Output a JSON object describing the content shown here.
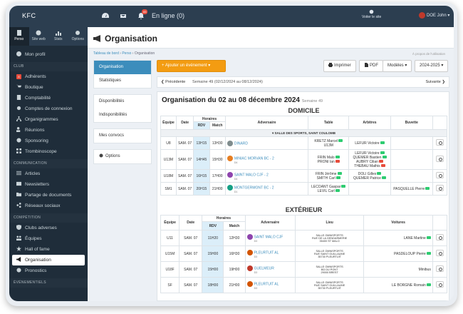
{
  "topbar": {
    "brand": "KFC",
    "online": "En ligne (0)",
    "notif_count": "65",
    "visit_site": "Voiter le site",
    "user": "DOE John"
  },
  "sidebar": {
    "tabs": [
      {
        "label": "Perso",
        "icon": "id-card-icon"
      },
      {
        "label": "Site web",
        "icon": "globe-icon"
      },
      {
        "label": "Stats",
        "icon": "chart-icon"
      },
      {
        "label": "Options",
        "icon": "gear-icon"
      }
    ],
    "profile": "Mon profil",
    "sections": [
      {
        "title": "CLUB",
        "items": [
          "Adhérents",
          "Boutique",
          "Comptabilité",
          "Comptes de connexion",
          "Organigrammes",
          "Réunions",
          "Sponsoring",
          "Trombinoscope"
        ]
      },
      {
        "title": "COMMUNICATION",
        "items": [
          "Articles",
          "Newsletters",
          "Partage de documents",
          "Réseaux sociaux"
        ]
      },
      {
        "title": "COMPÉTITION",
        "items": [
          "Clubs adverses",
          "Équipes",
          "Hall of fame",
          "Organisation",
          "Pronostics"
        ]
      },
      {
        "title": "ÉVÉNEMENTIELS",
        "items": []
      }
    ]
  },
  "page": {
    "title": "Organisation",
    "breadcrumb": [
      "Tableau de bord",
      "Perso",
      "Organisation"
    ],
    "hint": "À propos de l'utilisation"
  },
  "leftnav": {
    "group1": [
      "Organisation",
      "Statistiques"
    ],
    "group2": [
      "Disponibilités",
      "Indisponibilités"
    ],
    "group3": [
      "Mes convocs"
    ],
    "group4": [
      "Options"
    ]
  },
  "toolbar": {
    "add": "Ajouter un événement",
    "print": "Imprimer",
    "pdf": "PDF",
    "models": "Modèles",
    "season": "2024-2025"
  },
  "weekbar": {
    "prev": "Précédente",
    "week": "Semaine 49 (02/12/2024 au 08/12/2024)",
    "next": "Suivante"
  },
  "card": {
    "title": "Organisation du 02 au 08 décembre 2024",
    "week": "Semaine 49"
  },
  "home": {
    "title": "DOMICILE",
    "headers": [
      "Équipe",
      "Date",
      "Horaires",
      "RDV",
      "Match",
      "Adversaire",
      "Table",
      "Arbitres",
      "Buvette"
    ],
    "venue": "SALLE DES SPORTS, SAINT COULOMB",
    "rows": [
      {
        "team": "U8",
        "date": "SAM. 07",
        "rdv": "13H15",
        "match": "13H30",
        "opp": "DINARD",
        "div": "",
        "table": [
          "KRETZ Marcel",
          "U13M"
        ],
        "refs": [
          "LEFUR Victoire"
        ],
        "bar": ""
      },
      {
        "team": "U13M",
        "date": "SAM. 07",
        "rdv": "14H45",
        "match": "15H30",
        "opp": "MINIAC MORVAN BC - 2",
        "div": "D4",
        "table": [
          "FRIN Malo",
          "PRONI Ian"
        ],
        "refs": [
          "LEFUR Victoire",
          "QUEMER Bastien",
          "AUBRY Cilian",
          "THEBAU Mathis"
        ],
        "bar": ""
      },
      {
        "team": "U18M",
        "date": "SAM. 07",
        "rdv": "16H15",
        "match": "17H00",
        "opp": "SAINT MALO CJF - 2",
        "div": "D4",
        "table": [
          "FRIN Jérôme",
          "SMITH Carl"
        ],
        "refs": [
          "DOLI Gilles",
          "QUEMER Patrice"
        ],
        "bar": ""
      },
      {
        "team": "SM1",
        "date": "SAM. 07",
        "rdv": "20H15",
        "match": "21H00",
        "opp": "MONTGERMONT BC - 2",
        "div": "D1",
        "table": [
          "LECOANT Gaspar",
          "LEVIL Carl"
        ],
        "refs": [],
        "bar": "PASQUELLE Pierre"
      }
    ]
  },
  "away": {
    "title": "EXTÉRIEUR",
    "headers": [
      "Équipe",
      "Date",
      "Horaires",
      "RDV",
      "Match",
      "Adversaire",
      "Lieu",
      "Voitures"
    ],
    "rows": [
      {
        "team": "U11",
        "date": "SAM. 07",
        "rdv": "11H20",
        "match": "12H30",
        "opp": "SAINT MALO CJF",
        "div": "D3",
        "place": [
          "SALLE OMNISPORTS",
          "RUE DE LA GENDARMERIE",
          "35400 ST MALO"
        ],
        "cars": "LANE Martine"
      },
      {
        "team": "U15M",
        "date": "SAM. 07",
        "rdv": "15H00",
        "match": "16H30",
        "opp": "PLEURTUIT AL",
        "div": "D3",
        "place": [
          "SALLE OMNISPORTS",
          "RUE SAINT GUILLAUME",
          "35730 PLEURTUIT"
        ],
        "cars": "PASDELOUP Pierre"
      },
      {
        "team": "U18F",
        "date": "SAM. 07",
        "rdv": "15H00",
        "match": "19H00",
        "opp": "GUELMEUR",
        "div": "D3",
        "place": [
          "SALLE OMNISPORTS",
          "BD DU PONT",
          "29000 BREST"
        ],
        "cars": "Minibus"
      },
      {
        "team": "SF",
        "date": "SAM. 07",
        "rdv": "18H00",
        "match": "21H00",
        "opp": "PLEURTUIT AL",
        "div": "D3",
        "place": [
          "SALLE OMNISPORTS",
          "RUE SAINT GUILLAUME",
          "35730 PLEURTUIT"
        ],
        "cars": "LE BORGNE Romain"
      }
    ]
  },
  "colors": {
    "sidebar": "#1f2d3a",
    "topbar": "#2c3e50",
    "accent": "#3c8dbc",
    "orange": "#f39c12",
    "ok": "#2ecc71",
    "ko": "#e74c3c"
  }
}
